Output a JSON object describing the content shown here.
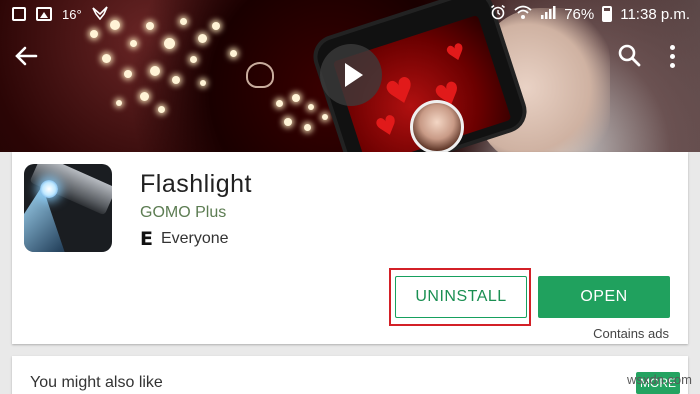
{
  "status_bar": {
    "temperature": "16°",
    "battery_percent": "76%",
    "time": "11:38 p.m.",
    "icons": [
      "notification-square-icon",
      "gallery-icon",
      "temperature",
      "bird-icon",
      "alarm-icon",
      "wifi-icon",
      "signal-icon",
      "battery-icon"
    ]
  },
  "toolbar": {
    "back_icon": "arrow-left-icon",
    "search_icon": "search-icon",
    "overflow_icon": "more-vert-icon"
  },
  "hero": {
    "play_icon": "play-icon"
  },
  "app": {
    "title": "Flashlight",
    "developer": "GOMO Plus",
    "rating_icon": "E",
    "rating": "Everyone",
    "uninstall_label": "UNINSTALL",
    "open_label": "OPEN",
    "ads_notice": "Contains ads"
  },
  "recommendations": {
    "title": "You might also like",
    "more_label": "MORE"
  },
  "watermark": "wsxdn.com",
  "colors": {
    "accent_green": "#20a15e",
    "highlight_red": "#d32027",
    "developer_green": "#5c7c52"
  }
}
